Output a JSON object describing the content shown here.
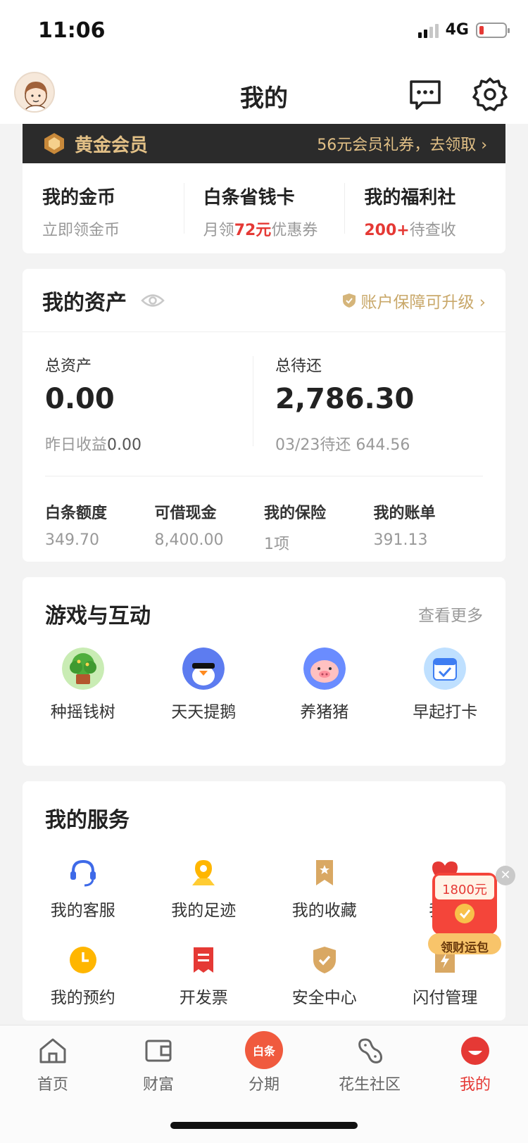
{
  "status": {
    "time": "11:06",
    "network": "4G"
  },
  "nav": {
    "title": "我的"
  },
  "member": {
    "title": "黄金会员",
    "promo": "56元会员礼券，去领取 ›"
  },
  "quick": [
    {
      "title": "我的金币",
      "sub": "立即领金币",
      "sub_pre": "",
      "sub_highlight": "",
      "sub_post": ""
    },
    {
      "title": "白条省钱卡",
      "sub": "",
      "sub_pre": "月领",
      "sub_highlight": "72元",
      "sub_post": "优惠券"
    },
    {
      "title": "我的福利社",
      "sub": "",
      "sub_pre": "",
      "sub_highlight": "200+",
      "sub_post": "待查收"
    }
  ],
  "assets": {
    "title": "我的资产",
    "protect": "账户保障可升级 ›",
    "total_label": "总资产",
    "total_value": "0.00",
    "total_sub_label": "昨日收益",
    "total_sub_value": "0.00",
    "due_label": "总待还",
    "due_value": "2,786.30",
    "due_sub": "03/23待还 644.56",
    "grid": [
      {
        "label": "白条额度",
        "value": "349.70"
      },
      {
        "label": "可借现金",
        "value": "8,400.00"
      },
      {
        "label": "我的保险",
        "value": "1项"
      },
      {
        "label": "我的账单",
        "value": "391.13"
      }
    ]
  },
  "games": {
    "title": "游戏与互动",
    "more": "查看更多",
    "items": [
      {
        "label": "种摇钱树",
        "icon": "money-tree-icon"
      },
      {
        "label": "天天提鹅",
        "icon": "goose-icon"
      },
      {
        "label": "养猪猪",
        "icon": "pig-icon"
      },
      {
        "label": "早起打卡",
        "icon": "calendar-check-icon"
      }
    ]
  },
  "services": {
    "title": "我的服务",
    "row1": [
      {
        "label": "我的客服",
        "icon": "headset-icon"
      },
      {
        "label": "我的足迹",
        "icon": "location-pin-icon"
      },
      {
        "label": "我的收藏",
        "icon": "bookmark-star-icon"
      },
      {
        "label": "我的",
        "icon": "heart-icon"
      }
    ],
    "row2": [
      {
        "label": "我的预约",
        "icon": "clock-icon"
      },
      {
        "label": "开发票",
        "icon": "invoice-icon"
      },
      {
        "label": "安全中心",
        "icon": "shield-check-icon"
      },
      {
        "label": "闪付管理",
        "icon": "flash-card-icon"
      }
    ]
  },
  "float_ad": {
    "amount": "1800元",
    "button": "领财运包"
  },
  "tabs": [
    {
      "label": "首页",
      "icon": "home-icon",
      "active": false
    },
    {
      "label": "财富",
      "icon": "wallet-icon",
      "active": false
    },
    {
      "label": "分期",
      "icon": "baitiao-icon",
      "badge": "白条",
      "active": false
    },
    {
      "label": "花生社区",
      "icon": "peanut-icon",
      "active": false
    },
    {
      "label": "我的",
      "icon": "profile-icon",
      "active": true
    }
  ],
  "colors": {
    "accent_red": "#e53935",
    "gold": "#c9a86a",
    "member_bg": "#2b2b2b"
  }
}
